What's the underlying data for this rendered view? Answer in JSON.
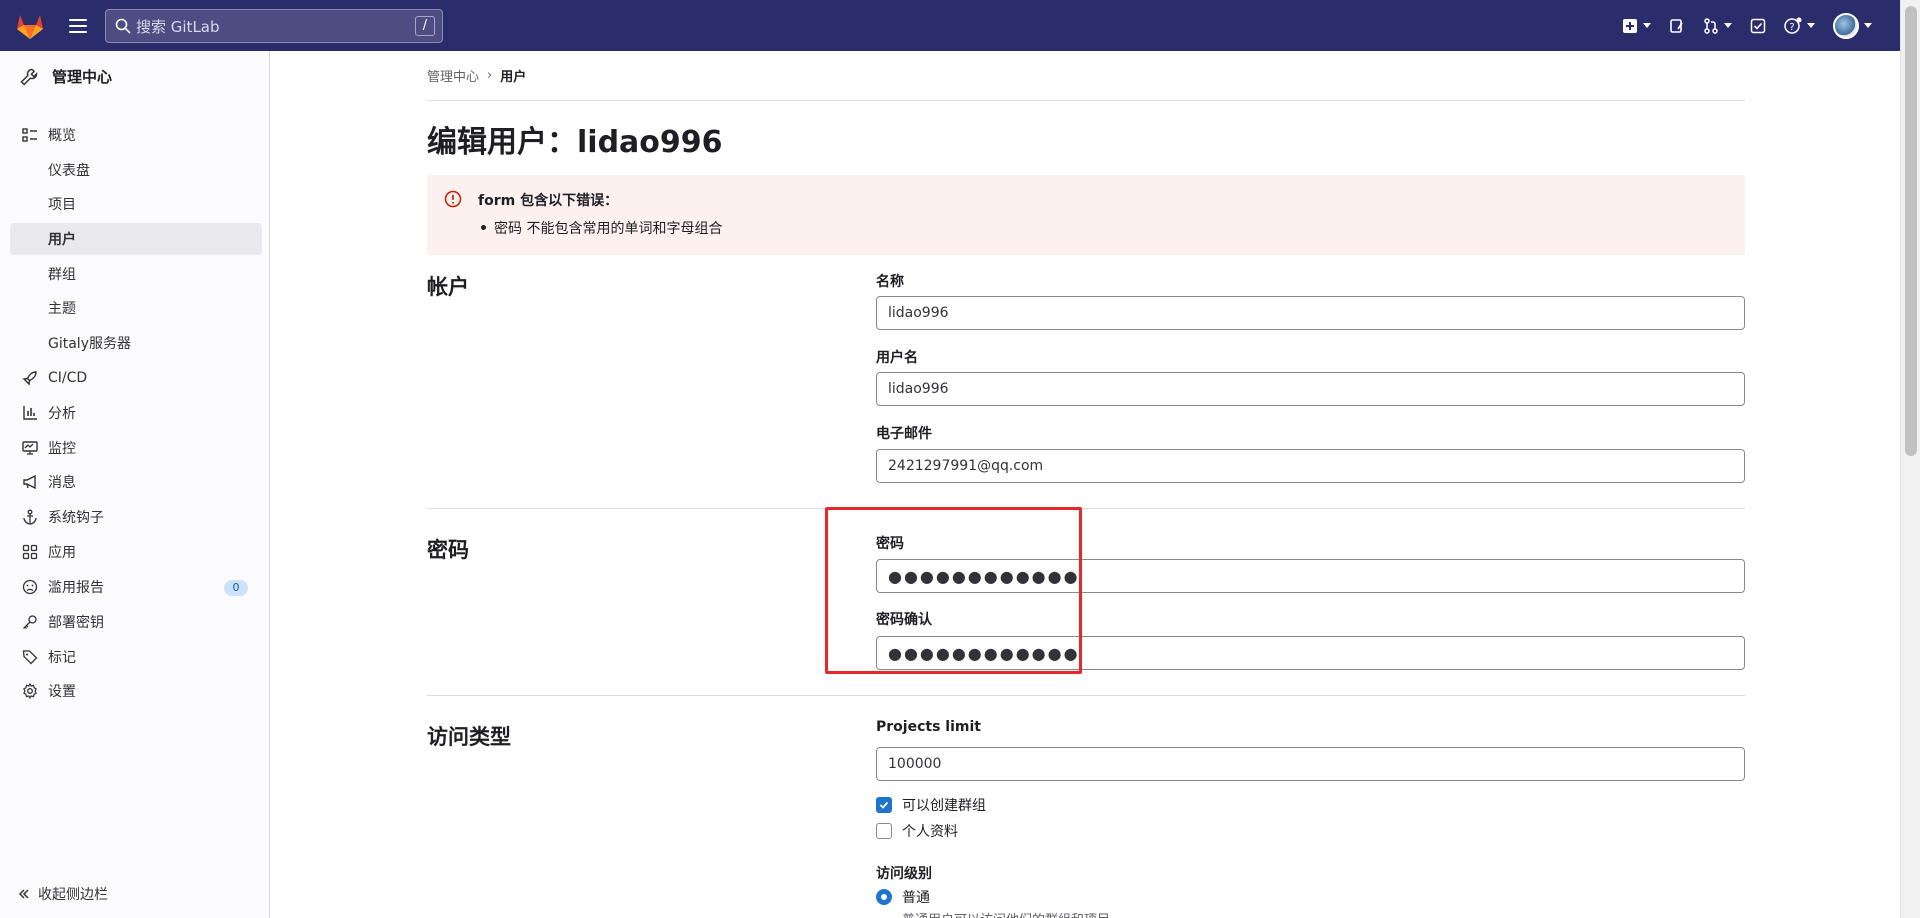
{
  "topbar": {
    "search_placeholder": "搜索 GitLab",
    "search_shortcut": "/"
  },
  "sidebar": {
    "header": "管理中心",
    "items": [
      {
        "label": "概览",
        "icon": "overview-icon"
      },
      {
        "label": "仪表盘"
      },
      {
        "label": "项目"
      },
      {
        "label": "用户",
        "active": true
      },
      {
        "label": "群组"
      },
      {
        "label": "主题"
      },
      {
        "label": "Gitaly服务器"
      },
      {
        "label": "CI/CD",
        "icon": "rocket-icon"
      },
      {
        "label": "分析",
        "icon": "chart-icon"
      },
      {
        "label": "监控",
        "icon": "monitor-icon"
      },
      {
        "label": "消息",
        "icon": "megaphone-icon"
      },
      {
        "label": "系统钩子",
        "icon": "anchor-icon"
      },
      {
        "label": "应用",
        "icon": "apps-icon"
      },
      {
        "label": "滥用报告",
        "icon": "abuse-icon",
        "badge": "0"
      },
      {
        "label": "部署密钥",
        "icon": "key-icon"
      },
      {
        "label": "标记",
        "icon": "label-icon"
      },
      {
        "label": "设置",
        "icon": "gear-icon"
      }
    ],
    "collapse_label": "收起侧边栏"
  },
  "breadcrumb": {
    "root": "管理中心",
    "current": "用户"
  },
  "page": {
    "title": "编辑用户：lidao996"
  },
  "alert": {
    "title": "form 包含以下错误：",
    "errors": [
      "密码 不能包含常用的单词和字母组合"
    ]
  },
  "account": {
    "heading": "帐户",
    "name_label": "名称",
    "name_value": "lidao996",
    "username_label": "用户名",
    "username_value": "lidao996",
    "email_label": "电子邮件",
    "email_value": "2421297991@qq.com"
  },
  "password": {
    "heading": "密码",
    "password_label": "密码",
    "password_value": "●●●●●●●●●●●●",
    "confirm_label": "密码确认",
    "confirm_value": "●●●●●●●●●●●●"
  },
  "access": {
    "heading": "访问类型",
    "projects_limit_label": "Projects limit",
    "projects_limit_value": "100000",
    "can_create_group_label": "可以创建群组",
    "can_create_group_checked": true,
    "private_profile_label": "个人资料",
    "private_profile_checked": false,
    "access_level_label": "访问级别",
    "level_regular_label": "普通",
    "level_regular_help": "普通用户可以访问他们的群组和项目"
  },
  "colors": {
    "topbar": "#2b2c6c",
    "accent": "#1f75cb",
    "alert_bg": "#fdf1ef",
    "highlight": "#e8272b"
  }
}
